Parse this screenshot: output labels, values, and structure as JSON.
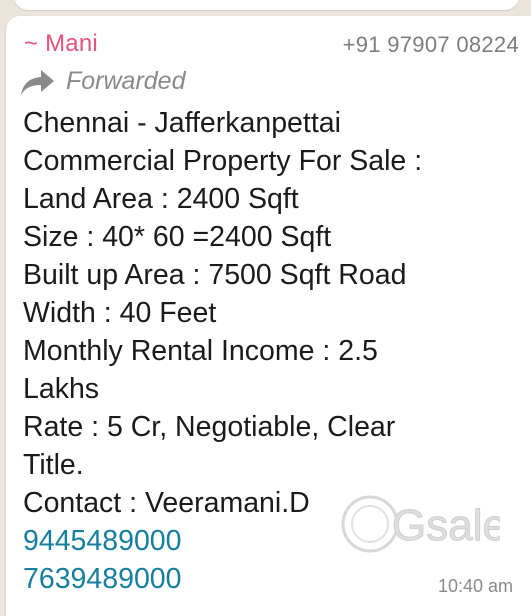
{
  "message": {
    "sender": "~ Mani",
    "sender_phone": "+91 97907 08224",
    "forwarded_label": "Forwarded",
    "lines": [
      "Chennai - Jafferkanpettai",
      "Commercial Property For Sale :",
      "Land Area : 2400 Sqft",
      "Size : 40* 60 =2400 Sqft",
      "Built up Area : 7500 Sqft Road",
      "Width : 40 Feet",
      "Monthly Rental Income : 2.5",
      "Lakhs",
      "Rate : 5 Cr,  Negotiable,  Clear",
      "Title.",
      "Contact : Veeramani.D"
    ],
    "phone_links": [
      "9445489000",
      "7639489000"
    ],
    "timestamp": "10:40 am"
  },
  "watermark": {
    "brand": "Gsale"
  },
  "icons": {
    "forward": "forward-arrow-icon"
  },
  "colors": {
    "sender": "#e5537a",
    "link": "#167f9e",
    "meta": "#7d7d7d",
    "chat_background": "#ece5dd",
    "bubble": "#ffffff"
  }
}
